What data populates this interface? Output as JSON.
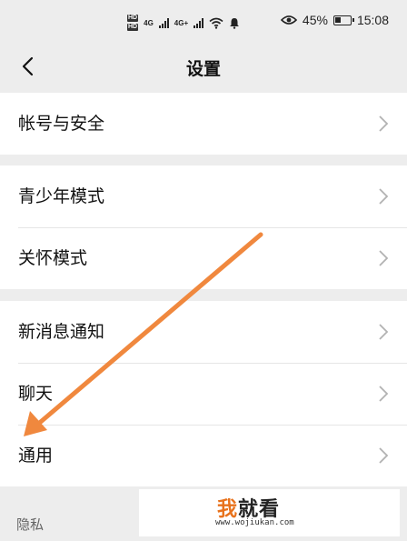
{
  "status_bar": {
    "battery_percent": "45%",
    "battery_level": 0.45,
    "time": "15:08",
    "network_badges": [
      "HD",
      "HD"
    ],
    "net_labels": [
      "4G",
      "4G+"
    ],
    "icons": [
      "signal-icon",
      "wifi-icon",
      "notification-bell-icon",
      "eye-icon",
      "battery-icon"
    ]
  },
  "header": {
    "title": "设置",
    "back_icon": "chevron-left-icon"
  },
  "groups": [
    {
      "items": [
        {
          "label": "帐号与安全"
        }
      ]
    },
    {
      "items": [
        {
          "label": "青少年模式"
        },
        {
          "label": "关怀模式"
        }
      ]
    },
    {
      "items": [
        {
          "label": "新消息通知"
        },
        {
          "label": "聊天"
        },
        {
          "label": "通用"
        }
      ]
    }
  ],
  "section_label": "隐私",
  "watermark": {
    "accent_char": "我",
    "rest": "就看",
    "url": "www.wojiukan.com"
  },
  "colors": {
    "background": "#ededed",
    "row": "#ffffff",
    "annotation_arrow": "#f0883e",
    "watermark_accent": "#e8721c"
  }
}
